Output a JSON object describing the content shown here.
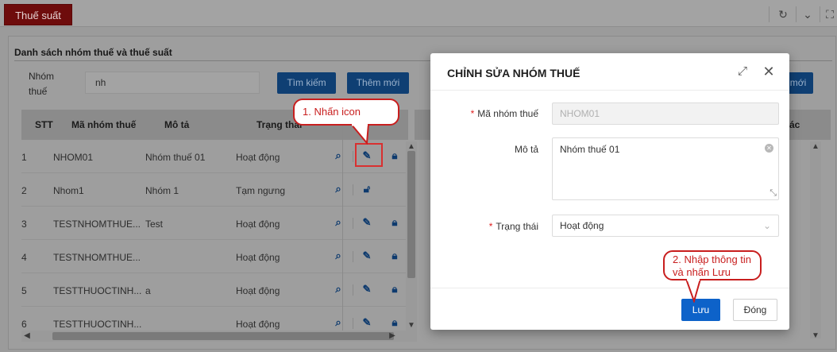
{
  "topbar": {
    "tab_label": "Thuế suất"
  },
  "panel": {
    "title": "Danh sách nhóm thuế và thuế suất",
    "search_label_line1": "Nhóm",
    "search_label_line2": "thuế",
    "search_value": "nh",
    "search_button": "Tìm kiếm",
    "add_button": "Thêm mới",
    "add_button_right": "mới"
  },
  "table": {
    "headers": [
      "STT",
      "Mã nhóm thuế",
      "Mô tả",
      "Trạng thái"
    ],
    "rows": [
      {
        "stt": "1",
        "code": "NHOM01",
        "desc": "Nhóm thuế 01",
        "status": "Hoạt động"
      },
      {
        "stt": "2",
        "code": "Nhom1",
        "desc": "Nhóm 1",
        "status": "Tạm ngưng"
      },
      {
        "stt": "3",
        "code": "TESTNHOMTHUE...",
        "desc": "Test",
        "status": "Hoạt động"
      },
      {
        "stt": "4",
        "code": "TESTNHOMTHUE...",
        "desc": "",
        "status": "Hoạt động"
      },
      {
        "stt": "5",
        "code": "TESTTHUOCTINH...",
        "desc": "a",
        "status": "Hoạt động"
      },
      {
        "stt": "6",
        "code": "TESTTHUOCTINH...",
        "desc": "",
        "status": "Hoạt động"
      }
    ],
    "right_header_tail": "tác"
  },
  "callouts": {
    "step1": "1. Nhấn icon",
    "step2_line1": "2. Nhập thông tin",
    "step2_line2": "và nhấn Lưu"
  },
  "modal": {
    "title": "CHỈNH SỬA NHÓM THUẾ",
    "required_mark": "*",
    "code_label": "Mã nhóm thuế",
    "code_value": "NHOM01",
    "desc_label": "Mô tả",
    "desc_value": "Nhóm thuế 01",
    "status_label": "Trạng thái",
    "status_value": "Hoạt động",
    "save_button": "Lưu",
    "close_button": "Đóng"
  },
  "colors": {
    "tab_active": "#6e0c0c",
    "primary_button": "#0d62c9",
    "callout_border": "#c81e1e",
    "required_star": "#e02020"
  },
  "icons": {
    "view": "search-icon",
    "edit": "pencil-icon",
    "lock": "lock-icon",
    "unlock": "unlock-icon",
    "refresh": "refresh-icon",
    "expand": "chevron-down-icon",
    "fullscreen": "fullscreen-icon",
    "maximize": "expand-icon",
    "close": "close-icon"
  }
}
